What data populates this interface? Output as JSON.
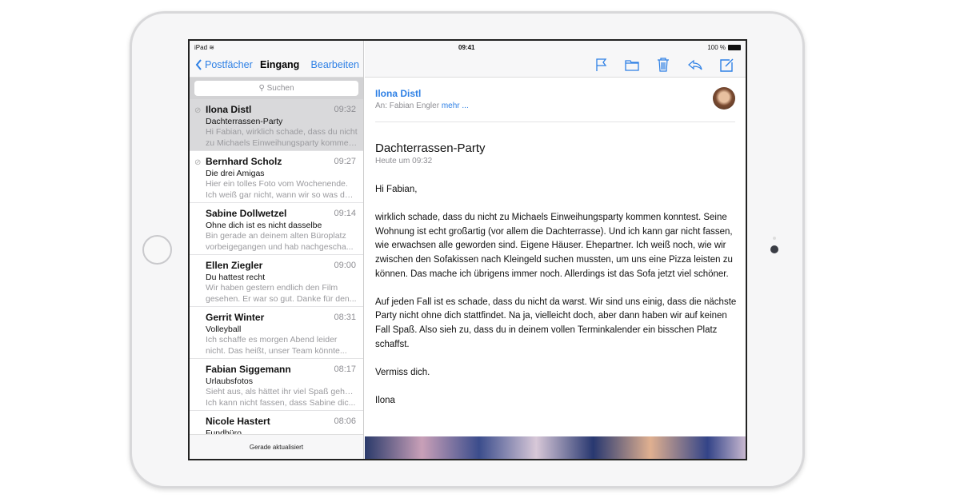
{
  "status": {
    "device": "iPad",
    "time": "09:41",
    "battery": "100 %"
  },
  "sidebar": {
    "back": "Postfächer",
    "title": "Eingang",
    "edit": "Bearbeiten",
    "search_placeholder": "Suchen",
    "footer": "Gerade aktualisiert",
    "messages": [
      {
        "from": "Ilona Distl",
        "time": "09:32",
        "subject": "Dachterrassen-Party",
        "preview1": "Hi Fabian, wirklich schade, dass du nicht",
        "preview2": "zu Michaels Einweihungsparty kommen...",
        "attachment": true,
        "selected": true
      },
      {
        "from": "Bernhard Scholz",
        "time": "09:27",
        "subject": "Die drei Amigas",
        "preview1": "Hier ein tolles Foto vom Wochenende.",
        "preview2": "Ich weiß gar nicht, wann wir so was das...",
        "attachment": true
      },
      {
        "from": "Sabine Dollwetzel",
        "time": "09:14",
        "subject": "Ohne dich ist es nicht dasselbe",
        "preview1": "Bin gerade an deinem alten Büroplatz",
        "preview2": "vorbeigegangen und hab nachgescha..."
      },
      {
        "from": "Ellen Ziegler",
        "time": "09:00",
        "subject": "Du hattest recht",
        "preview1": "Wir haben gestern endlich den Film",
        "preview2": "gesehen. Er war so gut. Danke für den..."
      },
      {
        "from": "Gerrit Winter",
        "time": "08:31",
        "subject": "Volleyball",
        "preview1": "Ich schaffe es morgen Abend leider",
        "preview2": "nicht. Das heißt, unser Team könnte..."
      },
      {
        "from": "Fabian Siggemann",
        "time": "08:17",
        "subject": "Urlaubsfotos",
        "preview1": "Sieht aus, als hättet ihr viel Spaß gehabt.",
        "preview2": "Ich kann nicht fassen, dass Sabine dic..."
      },
      {
        "from": "Nicole Hastert",
        "time": "08:06",
        "subject": "Fundbüro",
        "preview1": "",
        "preview2": ""
      }
    ]
  },
  "detail": {
    "toolbar_icons": [
      "flag-icon",
      "folder-icon",
      "trash-icon",
      "reply-icon",
      "compose-icon"
    ],
    "from": "Ilona Distl",
    "to_label": "An: Fabian Engler",
    "more": "mehr ...",
    "subject": "Dachterrassen-Party",
    "date": "Heute um 09:32",
    "body": [
      "Hi Fabian,",
      "wirklich schade, dass du nicht zu Michaels Einweihungsparty kommen konntest. Seine Wohnung ist echt großartig (vor allem die Dachterrasse). Und ich kann gar nicht fassen, wie erwachsen alle geworden sind. Eigene Häuser. Ehepartner. Ich weiß noch, wie wir zwischen den Sofakissen nach Kleingeld suchen mussten, um uns eine Pizza leisten zu können. Das mache ich übrigens immer noch. Allerdings ist das Sofa jetzt viel schöner.",
      "Auf jeden Fall ist es schade, dass du nicht da warst. Wir sind uns einig, dass die nächste Party nicht ohne dich stattfindet. Na ja, vielleicht doch, aber dann haben wir auf keinen Fall Spaß. Also sieh zu, dass du in deinem vollen Terminkalender ein bisschen Platz schaffst.",
      "Vermiss dich.",
      "Ilona"
    ]
  },
  "colors": {
    "accent": "#2e80e5"
  }
}
